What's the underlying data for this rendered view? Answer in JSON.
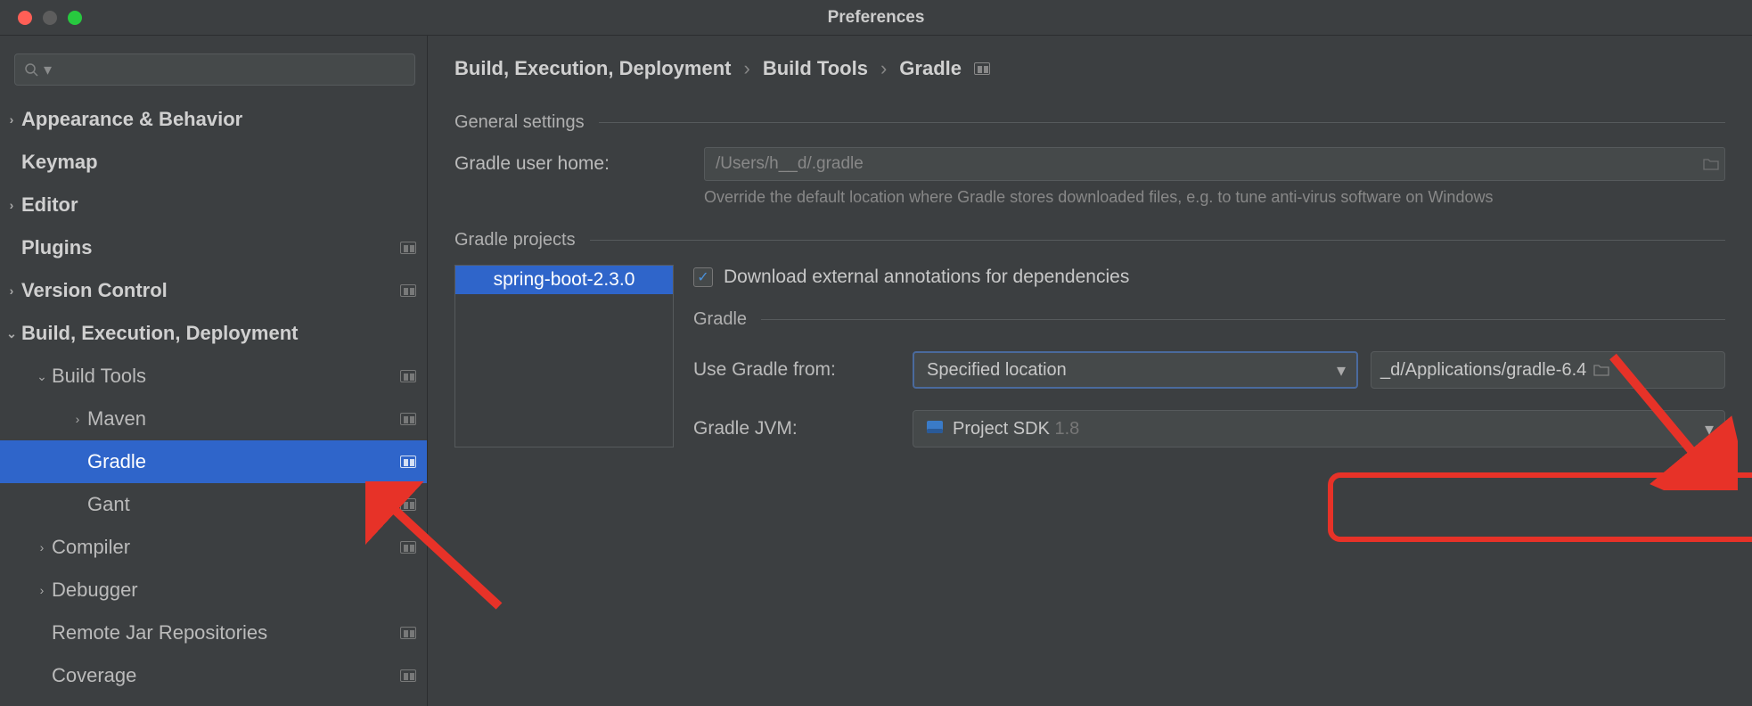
{
  "window": {
    "title": "Preferences"
  },
  "sidebar": {
    "items": [
      {
        "label": "Appearance & Behavior",
        "level": 0,
        "expandable": true,
        "expanded": false,
        "badge": false
      },
      {
        "label": "Keymap",
        "level": 0,
        "expandable": false,
        "badge": false
      },
      {
        "label": "Editor",
        "level": 0,
        "expandable": true,
        "expanded": false,
        "badge": false
      },
      {
        "label": "Plugins",
        "level": 0,
        "expandable": false,
        "badge": true
      },
      {
        "label": "Version Control",
        "level": 0,
        "expandable": true,
        "expanded": false,
        "badge": true
      },
      {
        "label": "Build, Execution, Deployment",
        "level": 0,
        "expandable": true,
        "expanded": true,
        "badge": false
      },
      {
        "label": "Build Tools",
        "level": 1,
        "expandable": true,
        "expanded": true,
        "badge": true
      },
      {
        "label": "Maven",
        "level": 2,
        "expandable": true,
        "expanded": false,
        "badge": true
      },
      {
        "label": "Gradle",
        "level": 2,
        "expandable": false,
        "badge": true,
        "selected": true
      },
      {
        "label": "Gant",
        "level": 2,
        "expandable": false,
        "badge": true
      },
      {
        "label": "Compiler",
        "level": 1,
        "expandable": true,
        "expanded": false,
        "badge": true
      },
      {
        "label": "Debugger",
        "level": 1,
        "expandable": true,
        "expanded": false,
        "badge": false
      },
      {
        "label": "Remote Jar Repositories",
        "level": 1,
        "expandable": false,
        "badge": true
      },
      {
        "label": "Coverage",
        "level": 1,
        "expandable": false,
        "badge": true
      }
    ]
  },
  "breadcrumb": {
    "a": "Build, Execution, Deployment",
    "b": "Build Tools",
    "c": "Gradle"
  },
  "general": {
    "header": "General settings",
    "home_label": "Gradle user home:",
    "home_placeholder": "/Users/h__d/.gradle",
    "hint": "Override the default location where Gradle stores downloaded files, e.g. to tune anti-virus software on Windows"
  },
  "projects": {
    "header": "Gradle projects",
    "selected": "spring-boot-2.3.0",
    "download_label": "Download external annotations for dependencies",
    "download_checked": true
  },
  "gradle": {
    "header": "Gradle",
    "use_from_label": "Use Gradle from:",
    "use_from_value": "Specified location",
    "path_value": "_d/Applications/gradle-6.4",
    "jvm_label": "Gradle JVM:",
    "jvm_prefix": "Project SDK",
    "jvm_version": "1.8"
  }
}
